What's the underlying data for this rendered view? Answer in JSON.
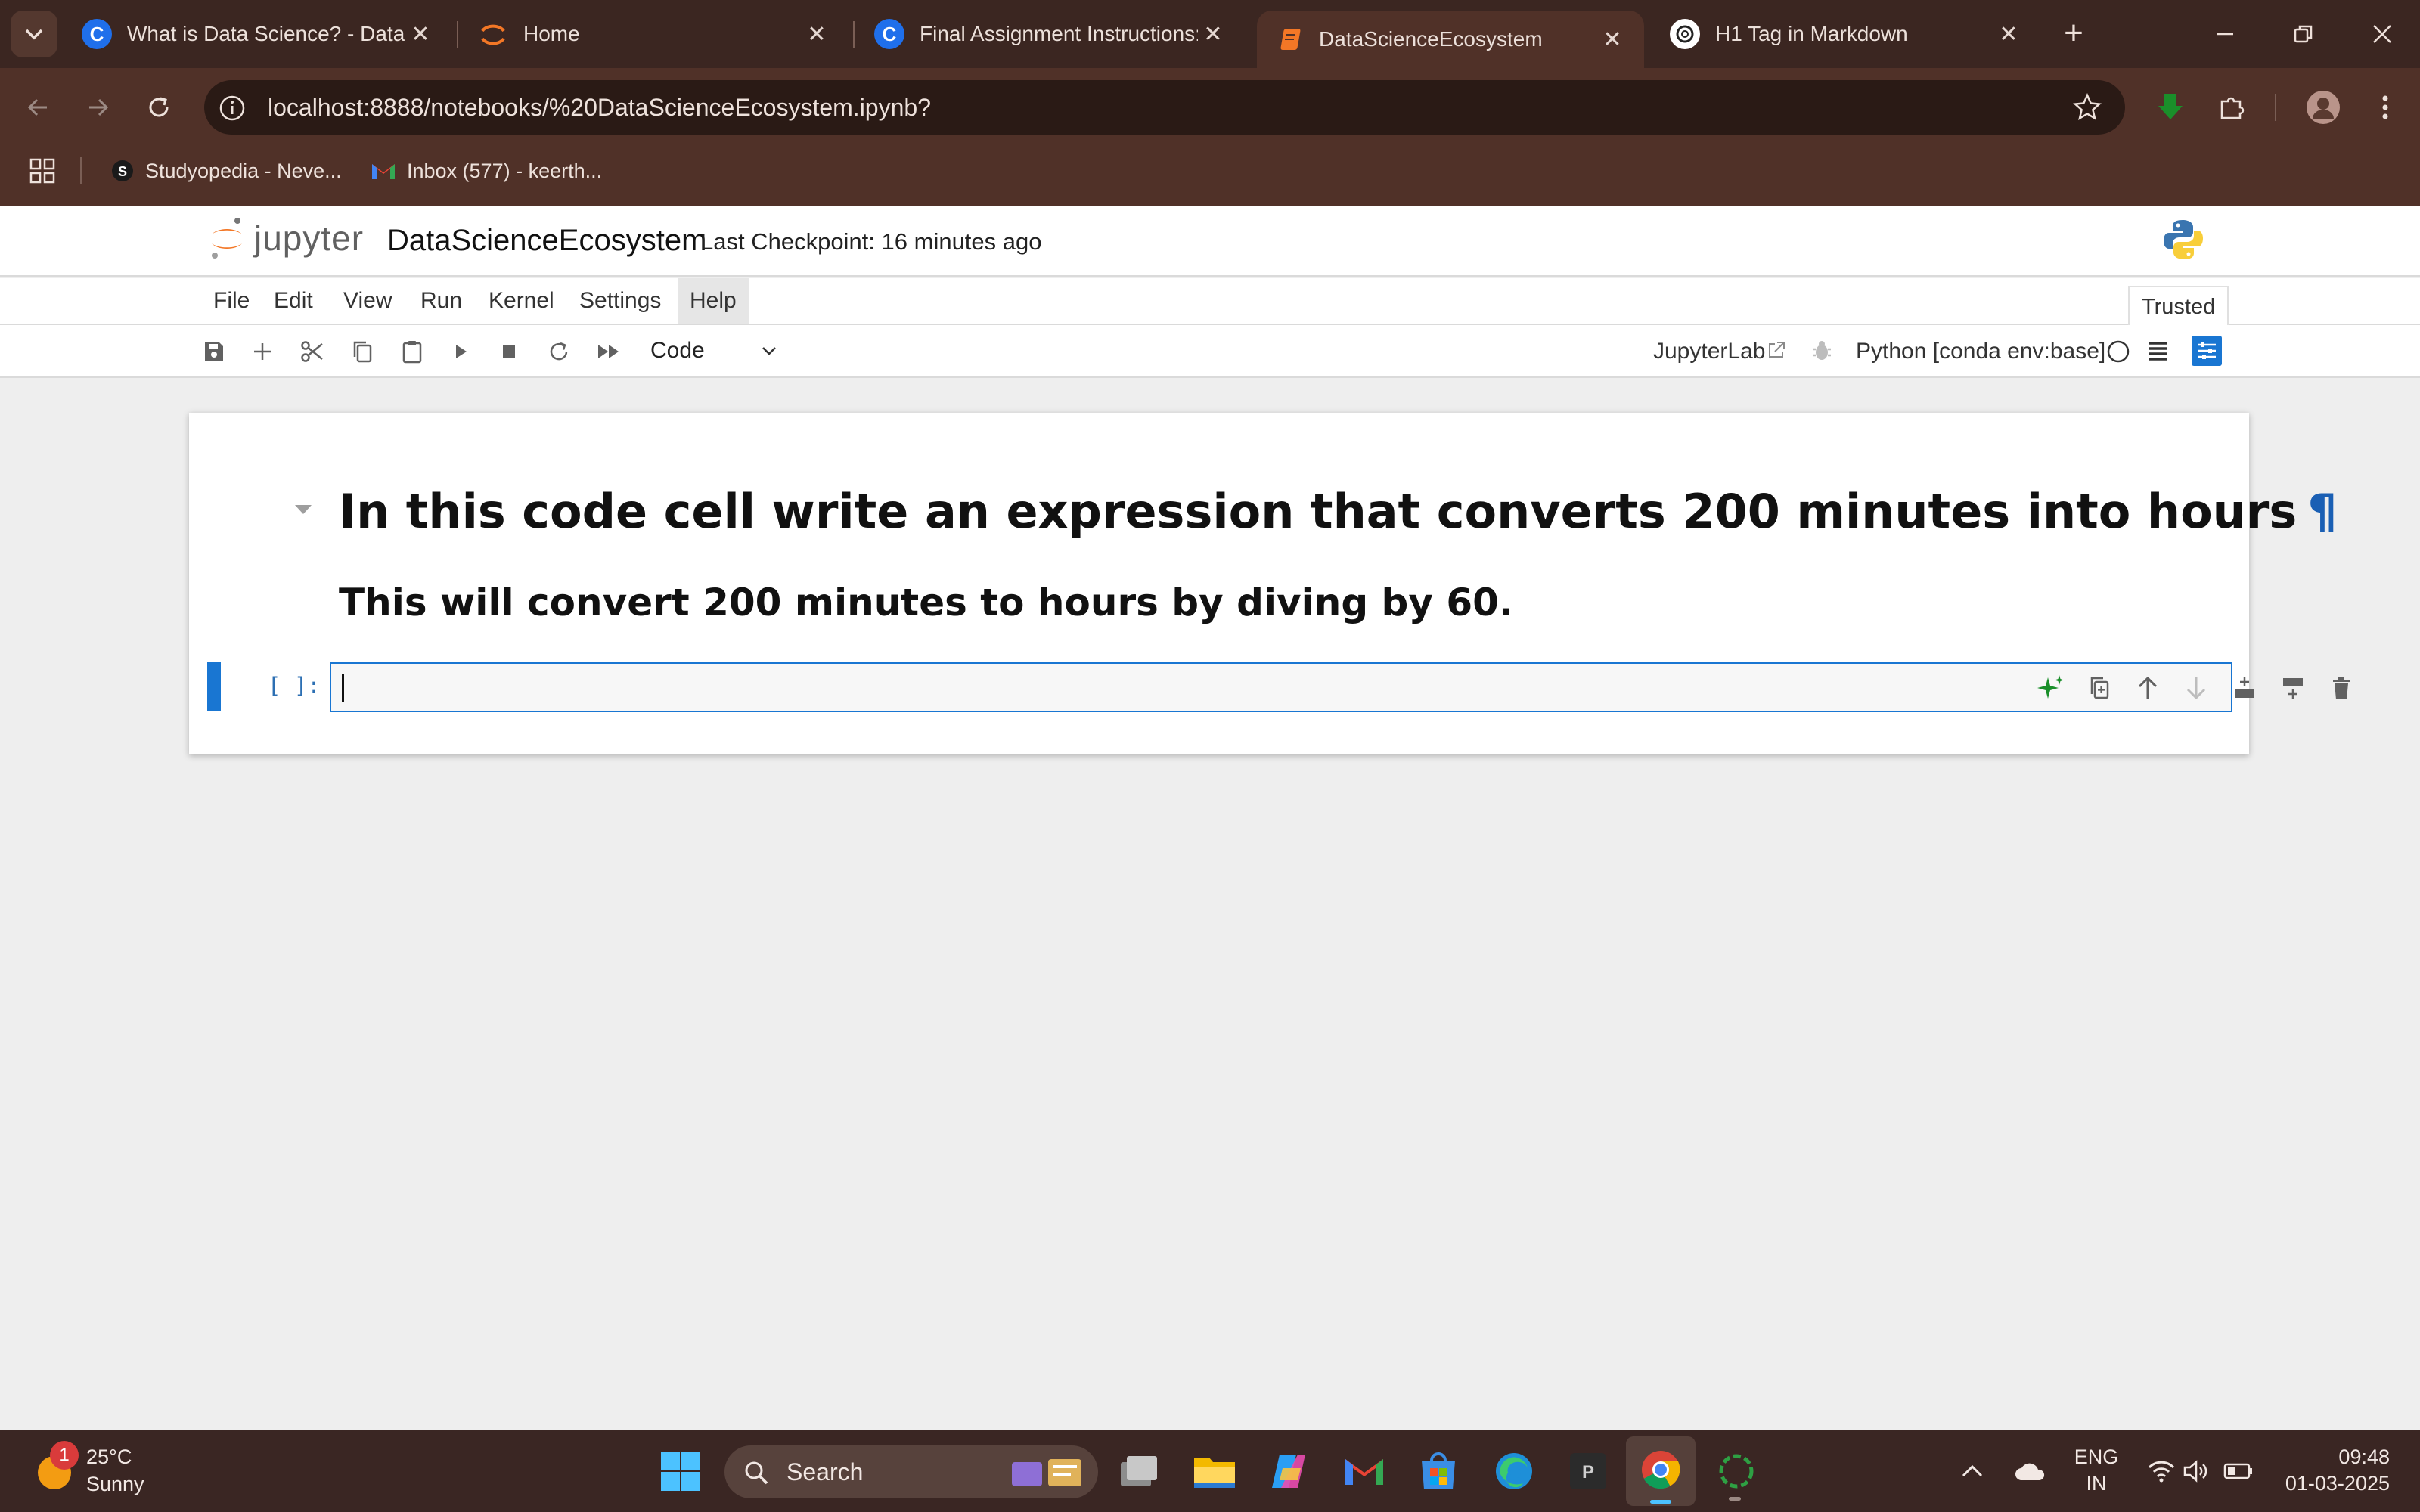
{
  "browser": {
    "tabs": [
      {
        "title": "What is Data Science? - Data li",
        "favicon": "c-icon",
        "active": false
      },
      {
        "title": "Home",
        "favicon": "jupyter-ring-icon",
        "active": false
      },
      {
        "title": "Final Assignment Instructions: ",
        "favicon": "c-icon",
        "active": false
      },
      {
        "title": "DataScienceEcosystem",
        "favicon": "notebook-icon",
        "active": true
      },
      {
        "title": "H1 Tag in Markdown",
        "favicon": "openai-icon",
        "active": false
      }
    ],
    "close_glyph": "✕",
    "new_tab_glyph": "+",
    "url": "localhost:8888/notebooks/%20DataScienceEcosystem.ipynb?",
    "bookmarks": [
      {
        "label": "Studyopedia - Neve...",
        "icon": "studyopedia-icon"
      },
      {
        "label": "Inbox (577) - keerth...",
        "icon": "gmail-icon"
      }
    ]
  },
  "jupyter": {
    "logo_text": "jupyter",
    "notebook_name": "DataScienceEcosystem",
    "checkpoint": "Last Checkpoint: 16 minutes ago",
    "menu": [
      "File",
      "Edit",
      "View",
      "Run",
      "Kernel",
      "Settings",
      "Help"
    ],
    "trusted": "Trusted",
    "cell_type": "Code",
    "jupyterlab_label": "JupyterLab",
    "kernel": "Python [conda env:base]"
  },
  "notebook": {
    "heading": "In this code cell write an expression that converts 200 minutes into hours",
    "pilcrow": "¶",
    "subheading": "This will convert 200 minutes to hours by diving by 60.",
    "prompt": "[ ]:",
    "code": ""
  },
  "taskbar": {
    "weather_temp": "25°C",
    "weather_condition": "Sunny",
    "weather_badge": "1",
    "search_label": "Search",
    "lang_line1": "ENG",
    "lang_line2": "IN",
    "time": "09:48",
    "date": "01-03-2025"
  },
  "colors": {
    "chrome_frame": "#3b2621",
    "chrome_toolbar": "#503128",
    "jupyter_accent": "#1976d2",
    "jupyter_orange": "#f37726",
    "taskbar": "#3a2623"
  }
}
